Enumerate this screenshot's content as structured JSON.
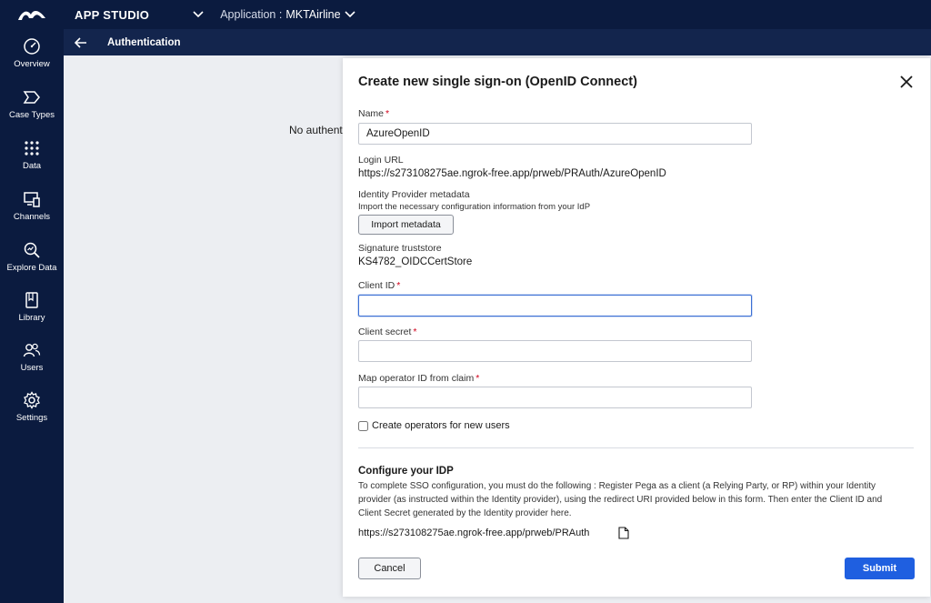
{
  "header": {
    "studio": "APP STUDIO",
    "application_label": "Application :",
    "application_name": "MKTAirline"
  },
  "sidebar": {
    "items": [
      {
        "label": "Overview",
        "icon": "gauge-icon"
      },
      {
        "label": "Case Types",
        "icon": "chevron-shape-icon"
      },
      {
        "label": "Data",
        "icon": "grid-dots-icon"
      },
      {
        "label": "Channels",
        "icon": "devices-icon"
      },
      {
        "label": "Explore Data",
        "icon": "magnifier-chart-icon"
      },
      {
        "label": "Library",
        "icon": "book-icon"
      },
      {
        "label": "Users",
        "icon": "users-icon"
      },
      {
        "label": "Settings",
        "icon": "gear-icon"
      }
    ]
  },
  "subheader": {
    "title": "Authentication"
  },
  "background": {
    "text": "No authenti"
  },
  "modal": {
    "title": "Create new single sign-on (OpenID Connect)",
    "name": {
      "label": "Name",
      "required": "*",
      "value": "AzureOpenID"
    },
    "login_url": {
      "label": "Login URL",
      "value": "https://s273108275ae.ngrok-free.app/prweb/PRAuth/AzureOpenID"
    },
    "idp_metadata": {
      "label": "Identity Provider metadata",
      "help": "Import the necessary configuration information from your IdP",
      "button": "Import metadata"
    },
    "truststore": {
      "label": "Signature truststore",
      "value": "KS4782_OIDCCertStore"
    },
    "client_id": {
      "label": "Client ID",
      "required": "*",
      "value": ""
    },
    "client_secret": {
      "label": "Client secret",
      "required": "*",
      "value": ""
    },
    "map_operator": {
      "label": "Map operator ID from claim",
      "required": "*",
      "value": ""
    },
    "create_operators": {
      "label": "Create operators for new users",
      "checked": false
    },
    "configure": {
      "title": "Configure your IDP",
      "description": "To complete SSO configuration, you must do the following : Register Pega as a client (a Relying Party, or RP) within your Identity provider (as instructed within the Identity provider), using the redirect URI provided below in this form. Then enter the Client ID and Client Secret generated by the Identity provider here.",
      "redirect_uri": "https://s273108275ae.ngrok-free.app/prweb/PRAuth"
    },
    "buttons": {
      "cancel": "Cancel",
      "submit": "Submit"
    }
  },
  "colors": {
    "nav_bg": "#0b1b3f",
    "subheader_bg": "#13254d",
    "primary": "#1f5fe0",
    "required": "#d0021b"
  }
}
